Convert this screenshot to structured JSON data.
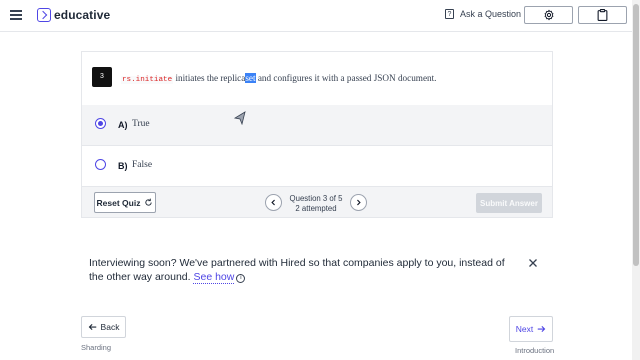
{
  "header": {
    "logo_text": "educative",
    "ask_label": "Ask a Question"
  },
  "question": {
    "number": "3",
    "code": "rs.initiate",
    "text_before": " initiates the replica",
    "text_selected": "set",
    "text_after": " and configures it with a passed JSON document."
  },
  "options": [
    {
      "letter": "A)",
      "label": "True",
      "selected": true
    },
    {
      "letter": "B)",
      "label": "False",
      "selected": false
    }
  ],
  "quiz_footer": {
    "reset_label": "Reset Quiz",
    "status_line1": "Question 3 of 5",
    "status_line2": "2 attempted",
    "submit_label": "Submit Answer"
  },
  "promo": {
    "text": "Interviewing soon? We've partnered with Hired so that companies apply to you, instead of the other way around. ",
    "link_text": "See how"
  },
  "navigation": {
    "back_label": "Back",
    "back_subtitle": "Sharding",
    "next_label": "Next",
    "next_subtitle": "Introduction"
  },
  "colors": {
    "accent": "#4f46e5",
    "code_red": "#dc2626",
    "selection": "#3b82f6"
  }
}
